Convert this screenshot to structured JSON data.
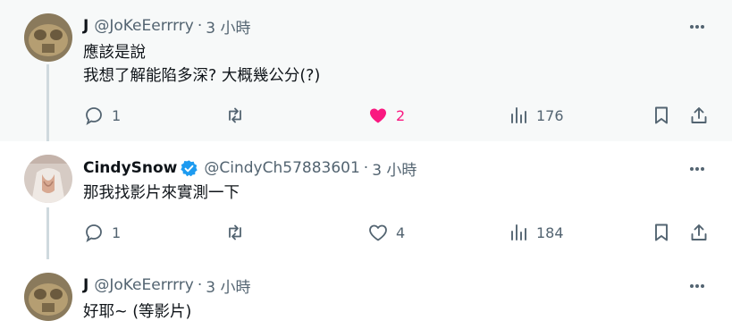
{
  "tweets": [
    {
      "author": "J",
      "handle": "@JoKeEerrrry",
      "time": "3 小時",
      "lines": [
        "應該是說",
        "我想了解能陷多深? 大概幾公分(?)"
      ],
      "replies": "1",
      "likes": "2",
      "views": "176",
      "liked": true,
      "verified": false
    },
    {
      "author": "CindySnow",
      "handle": "@CindyCh57883601",
      "time": "3 小時",
      "lines": [
        "那我找影片來實測一下"
      ],
      "replies": "1",
      "likes": "4",
      "views": "184",
      "liked": false,
      "verified": true
    },
    {
      "author": "J",
      "handle": "@JoKeEerrrry",
      "time": "3 小時",
      "lines": [
        "好耶~ (等影片)"
      ]
    }
  ],
  "separator": "·",
  "colors": {
    "like_active": "#f91880",
    "verified": "#1d9bf0",
    "muted": "#536471",
    "thread_line": "#cfd9de",
    "highlight_bg": "#f7f9f9"
  },
  "icons": [
    "more-icon",
    "reply-icon",
    "retweet-icon",
    "like-icon",
    "views-icon",
    "bookmark-icon",
    "share-icon",
    "verified-badge-icon"
  ]
}
